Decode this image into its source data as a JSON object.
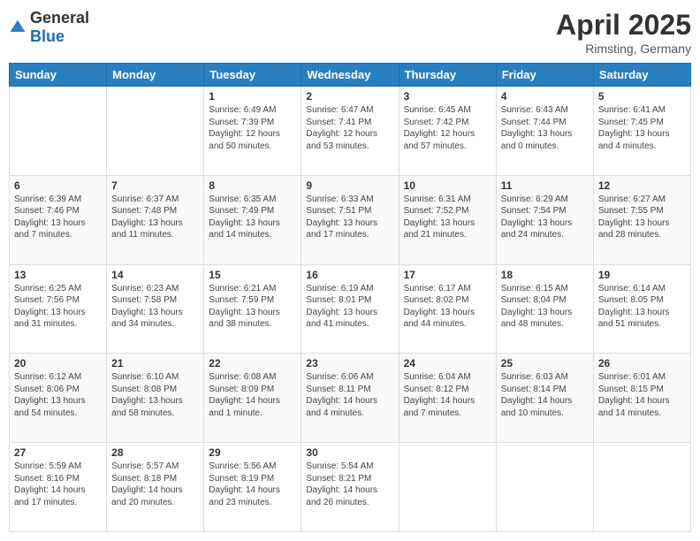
{
  "logo": {
    "general": "General",
    "blue": "Blue"
  },
  "header": {
    "month": "April 2025",
    "location": "Rimsting, Germany"
  },
  "days_of_week": [
    "Sunday",
    "Monday",
    "Tuesday",
    "Wednesday",
    "Thursday",
    "Friday",
    "Saturday"
  ],
  "weeks": [
    [
      {
        "day": "",
        "detail": ""
      },
      {
        "day": "",
        "detail": ""
      },
      {
        "day": "1",
        "detail": "Sunrise: 6:49 AM\nSunset: 7:39 PM\nDaylight: 12 hours and 50 minutes."
      },
      {
        "day": "2",
        "detail": "Sunrise: 6:47 AM\nSunset: 7:41 PM\nDaylight: 12 hours and 53 minutes."
      },
      {
        "day": "3",
        "detail": "Sunrise: 6:45 AM\nSunset: 7:42 PM\nDaylight: 12 hours and 57 minutes."
      },
      {
        "day": "4",
        "detail": "Sunrise: 6:43 AM\nSunset: 7:44 PM\nDaylight: 13 hours and 0 minutes."
      },
      {
        "day": "5",
        "detail": "Sunrise: 6:41 AM\nSunset: 7:45 PM\nDaylight: 13 hours and 4 minutes."
      }
    ],
    [
      {
        "day": "6",
        "detail": "Sunrise: 6:39 AM\nSunset: 7:46 PM\nDaylight: 13 hours and 7 minutes."
      },
      {
        "day": "7",
        "detail": "Sunrise: 6:37 AM\nSunset: 7:48 PM\nDaylight: 13 hours and 11 minutes."
      },
      {
        "day": "8",
        "detail": "Sunrise: 6:35 AM\nSunset: 7:49 PM\nDaylight: 13 hours and 14 minutes."
      },
      {
        "day": "9",
        "detail": "Sunrise: 6:33 AM\nSunset: 7:51 PM\nDaylight: 13 hours and 17 minutes."
      },
      {
        "day": "10",
        "detail": "Sunrise: 6:31 AM\nSunset: 7:52 PM\nDaylight: 13 hours and 21 minutes."
      },
      {
        "day": "11",
        "detail": "Sunrise: 6:29 AM\nSunset: 7:54 PM\nDaylight: 13 hours and 24 minutes."
      },
      {
        "day": "12",
        "detail": "Sunrise: 6:27 AM\nSunset: 7:55 PM\nDaylight: 13 hours and 28 minutes."
      }
    ],
    [
      {
        "day": "13",
        "detail": "Sunrise: 6:25 AM\nSunset: 7:56 PM\nDaylight: 13 hours and 31 minutes."
      },
      {
        "day": "14",
        "detail": "Sunrise: 6:23 AM\nSunset: 7:58 PM\nDaylight: 13 hours and 34 minutes."
      },
      {
        "day": "15",
        "detail": "Sunrise: 6:21 AM\nSunset: 7:59 PM\nDaylight: 13 hours and 38 minutes."
      },
      {
        "day": "16",
        "detail": "Sunrise: 6:19 AM\nSunset: 8:01 PM\nDaylight: 13 hours and 41 minutes."
      },
      {
        "day": "17",
        "detail": "Sunrise: 6:17 AM\nSunset: 8:02 PM\nDaylight: 13 hours and 44 minutes."
      },
      {
        "day": "18",
        "detail": "Sunrise: 6:15 AM\nSunset: 8:04 PM\nDaylight: 13 hours and 48 minutes."
      },
      {
        "day": "19",
        "detail": "Sunrise: 6:14 AM\nSunset: 8:05 PM\nDaylight: 13 hours and 51 minutes."
      }
    ],
    [
      {
        "day": "20",
        "detail": "Sunrise: 6:12 AM\nSunset: 8:06 PM\nDaylight: 13 hours and 54 minutes."
      },
      {
        "day": "21",
        "detail": "Sunrise: 6:10 AM\nSunset: 8:08 PM\nDaylight: 13 hours and 58 minutes."
      },
      {
        "day": "22",
        "detail": "Sunrise: 6:08 AM\nSunset: 8:09 PM\nDaylight: 14 hours and 1 minute."
      },
      {
        "day": "23",
        "detail": "Sunrise: 6:06 AM\nSunset: 8:11 PM\nDaylight: 14 hours and 4 minutes."
      },
      {
        "day": "24",
        "detail": "Sunrise: 6:04 AM\nSunset: 8:12 PM\nDaylight: 14 hours and 7 minutes."
      },
      {
        "day": "25",
        "detail": "Sunrise: 6:03 AM\nSunset: 8:14 PM\nDaylight: 14 hours and 10 minutes."
      },
      {
        "day": "26",
        "detail": "Sunrise: 6:01 AM\nSunset: 8:15 PM\nDaylight: 14 hours and 14 minutes."
      }
    ],
    [
      {
        "day": "27",
        "detail": "Sunrise: 5:59 AM\nSunset: 8:16 PM\nDaylight: 14 hours and 17 minutes."
      },
      {
        "day": "28",
        "detail": "Sunrise: 5:57 AM\nSunset: 8:18 PM\nDaylight: 14 hours and 20 minutes."
      },
      {
        "day": "29",
        "detail": "Sunrise: 5:56 AM\nSunset: 8:19 PM\nDaylight: 14 hours and 23 minutes."
      },
      {
        "day": "30",
        "detail": "Sunrise: 5:54 AM\nSunset: 8:21 PM\nDaylight: 14 hours and 26 minutes."
      },
      {
        "day": "",
        "detail": ""
      },
      {
        "day": "",
        "detail": ""
      },
      {
        "day": "",
        "detail": ""
      }
    ]
  ]
}
